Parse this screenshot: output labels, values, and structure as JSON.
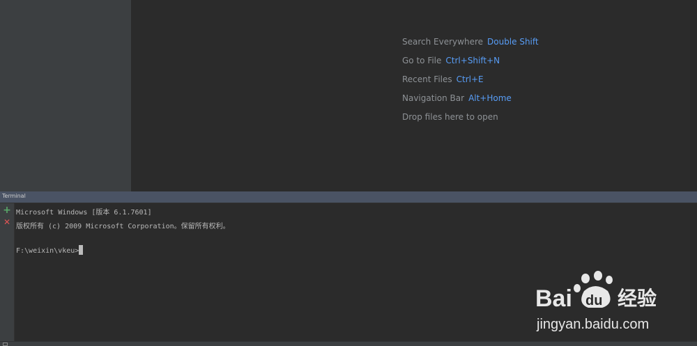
{
  "editor": {
    "hints": [
      {
        "label": "Search Everywhere",
        "shortcut": "Double Shift"
      },
      {
        "label": "Go to File",
        "shortcut": "Ctrl+Shift+N"
      },
      {
        "label": "Recent Files",
        "shortcut": "Ctrl+E"
      },
      {
        "label": "Navigation Bar",
        "shortcut": "Alt+Home"
      },
      {
        "label": "Drop files here to open",
        "shortcut": ""
      }
    ]
  },
  "terminal": {
    "title": "Terminal",
    "lines": [
      "Microsoft Windows [版本 6.1.7601]",
      "版权所有 (c) 2009 Microsoft Corporation。保留所有权利。",
      "",
      "F:\\weixin\\vkeu>"
    ],
    "toolbar": {
      "add_icon": "plus-icon",
      "close_icon": "close-icon"
    }
  },
  "watermark": {
    "brand": "Bai",
    "brand2": "du",
    "cn": "经验",
    "url": "jingyan.baidu.com"
  },
  "colors": {
    "editor_bg": "#2b2b2b",
    "panel_bg": "#3c3f41",
    "terminal_header_bg": "#4a5364",
    "shortcut_blue": "#589df6",
    "hint_gray": "#8e9296",
    "add_green": "#59a869",
    "close_red": "#e05555"
  }
}
